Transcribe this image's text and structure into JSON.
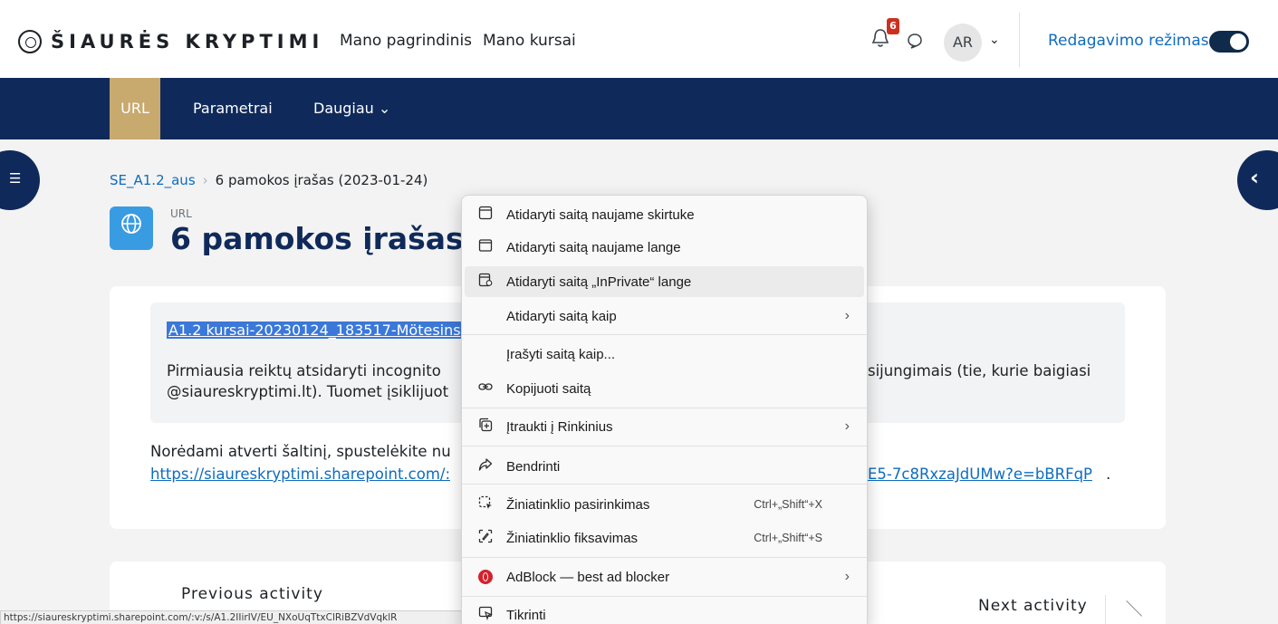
{
  "brand": {
    "name": "ŠIAURĖS KRYPTIMI"
  },
  "topnav": {
    "items": [
      "Mano pagrindinis",
      "Mano kursai"
    ]
  },
  "user": {
    "notification_count": "6",
    "avatar_initials": "AR",
    "edit_mode_label": "Redagavimo režimas"
  },
  "secnav": {
    "tabs": [
      "URL",
      "Parametrai",
      "Daugiau"
    ]
  },
  "breadcrumb": {
    "course": "SE_A1.2_aus",
    "current": "6 pamokos įrašas (2023-01-24)"
  },
  "header": {
    "activity_type": "URL",
    "title": "6 pamokos įrašas"
  },
  "content": {
    "file_link": "A1.2 kursai-20230124_183517-Mötesinsp",
    "intro_line1_start": "Pirmiausia reiktų atsidaryti incognito",
    "intro_line1_end": "sijungimais (tie, kurie baigiasi",
    "intro_line2": "@siaureskryptimi.lt). Tuomet įsiklijuot",
    "open_text": "Norėdami atverti šaltinį, spustelėkite nu",
    "url_start": "https://siaureskryptimi.sharepoint.com/:",
    "url_end": "E5-7c8RxzaJdUMw?e=bBRFqP",
    "url_period": "."
  },
  "activity_nav": {
    "previous": "Previous activity",
    "next": "Next activity"
  },
  "status_bar": {
    "url": "https://siaureskryptimi.sharepoint.com/:v:/s/A1.2IIirIV/EU_NXoUqTtxClRiBZVdVqklR"
  },
  "context_menu": {
    "items": [
      {
        "label": "Atidaryti saitą naujame skirtuke",
        "icon": "new-tab-icon"
      },
      {
        "label": "Atidaryti saitą naujame lange",
        "icon": "new-window-icon"
      },
      {
        "label": "Atidaryti saitą „InPrivate“ lange",
        "icon": "inprivate-icon"
      },
      {
        "label": "Atidaryti saitą kaip",
        "icon": ""
      },
      {
        "label": "Įrašyti saitą kaip...",
        "icon": ""
      },
      {
        "label": "Kopijuoti saitą",
        "icon": "link-icon"
      },
      {
        "label": "Įtraukti į Rinkinius",
        "icon": "collections-icon"
      },
      {
        "label": "Bendrinti",
        "icon": "share-icon"
      },
      {
        "label": "Žiniatinklio pasirinkimas",
        "icon": "web-select-icon",
        "shortcut": "Ctrl+„Shift“+X"
      },
      {
        "label": "Žiniatinklio fiksavimas",
        "icon": "web-capture-icon",
        "shortcut": "Ctrl+„Shift“+S"
      },
      {
        "label": "AdBlock — best ad blocker",
        "icon": "adblock-icon"
      },
      {
        "label": "Tikrinti",
        "icon": "inspect-icon"
      }
    ]
  }
}
